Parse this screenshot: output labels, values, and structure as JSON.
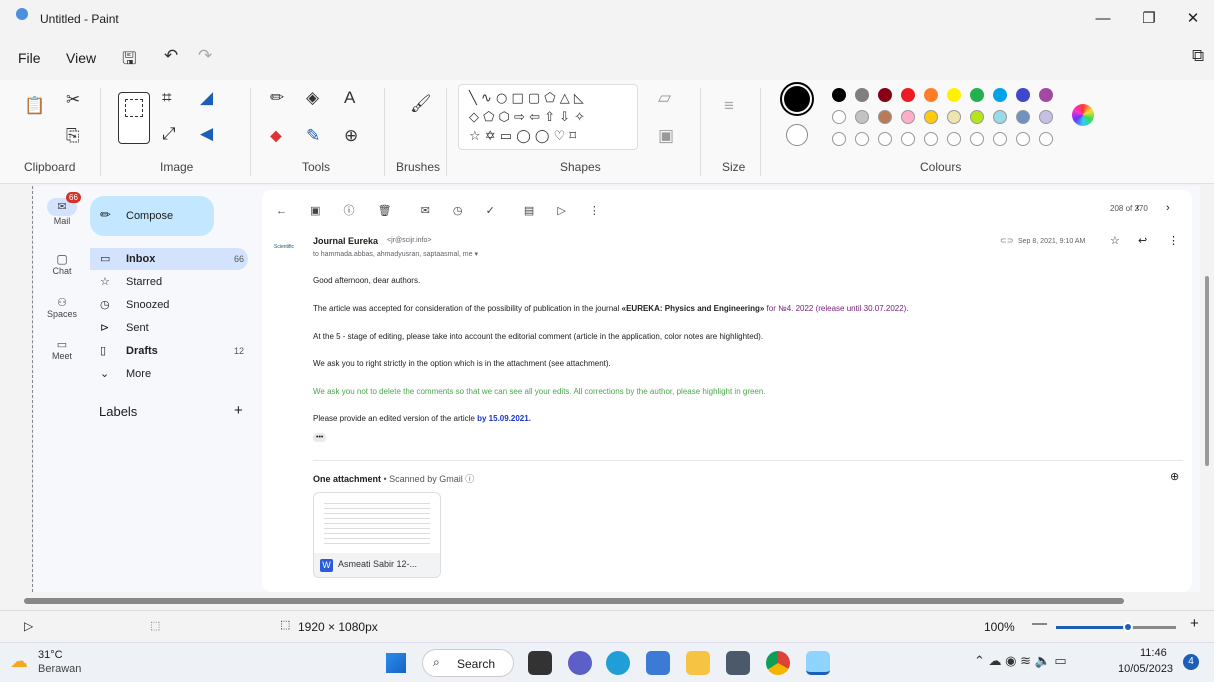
{
  "window": {
    "title": "Untitled - Paint",
    "minimize": "—",
    "restore": "❐",
    "close": "✕"
  },
  "menu": {
    "file": "File",
    "view": "View"
  },
  "ribbon": {
    "groups": [
      "Clipboard",
      "Image",
      "Tools",
      "Brushes",
      "Shapes",
      "Size",
      "Colours"
    ],
    "shapes_row1": "╲ ∿ ○ □ ▢ ⬠ △ ◺",
    "shapes_row2": "◇ ⬠ ⬡ ⇨ ⇦ ⇧ ⇩ ✧",
    "shapes_row3": "☆ ✡ ▭ ◯ ◯ ♡ ⌑",
    "colors_row1": [
      "#000000",
      "#7f7f7f",
      "#880015",
      "#ed1c24",
      "#ff7f27",
      "#fff200",
      "#22b14c",
      "#00a2e8",
      "#3f48cc",
      "#a349a4"
    ],
    "colors_row2": [
      "#ffffff",
      "#c3c3c3",
      "#b97a57",
      "#ffaec9",
      "#ffc90e",
      "#efe4b0",
      "#b5e61d",
      "#99d9ea",
      "#7092be",
      "#c8bfe7"
    ]
  },
  "gmail": {
    "rail": {
      "mail": "Mail",
      "mail_badge": "66",
      "chat": "Chat",
      "spaces": "Spaces",
      "meet": "Meet"
    },
    "compose": "Compose",
    "nav": [
      {
        "label": "Inbox",
        "count": "66"
      },
      {
        "label": "Starred",
        "count": ""
      },
      {
        "label": "Snoozed",
        "count": ""
      },
      {
        "label": "Sent",
        "count": ""
      },
      {
        "label": "Drafts",
        "count": "12"
      },
      {
        "label": "More",
        "count": ""
      }
    ],
    "labels": "Labels",
    "labels_add": "+",
    "pager": "208 of 270",
    "sender_name": "Journal Eureka",
    "sender_email": "<jr@scijr.info>",
    "recipients": "to hammada.abbas, ahmadyusran, saptaasmal, me ▾",
    "date": "Sep 8, 2021, 9:10 AM",
    "avatar_text": "Scientific",
    "greeting": "Good afternoon, dear authors.",
    "p1_a": "The article was accepted for consideration of the possibility of publication in the journal ",
    "p1_b": "«EUREKA: Physics and Engineering»",
    "p1_c": " for №4. 2022 (release until 30.07.2022).",
    "p2": "At the 5 - stage of editing, please take into account the editorial comment  (article in the application, color notes are highlighted).",
    "p3": "We ask you to right strictly in the option which is in the attachment (see attachment).",
    "p4": "We ask you not to delete the comments so that we can see all your edits. All corrections by the author, please highlight in green.",
    "p5_a": "Please provide an edited version of the article ",
    "p5_b": "by 15.09.2021.",
    "ellipsis": "•••",
    "attach_title": "One attachment",
    "attach_scan": " • Scanned by Gmail ⓘ",
    "attach_file": "Asmeati Sabir 12-...",
    "attach_w": "W"
  },
  "status": {
    "canvas_size": "1920 × 1080px",
    "zoom": "100%",
    "zoom_level": 0.6
  },
  "taskbar": {
    "weather_temp": "31°C",
    "weather_desc": "Berawan",
    "search": "Search",
    "time": "11:46",
    "date": "10/05/2023",
    "notif": "4"
  }
}
